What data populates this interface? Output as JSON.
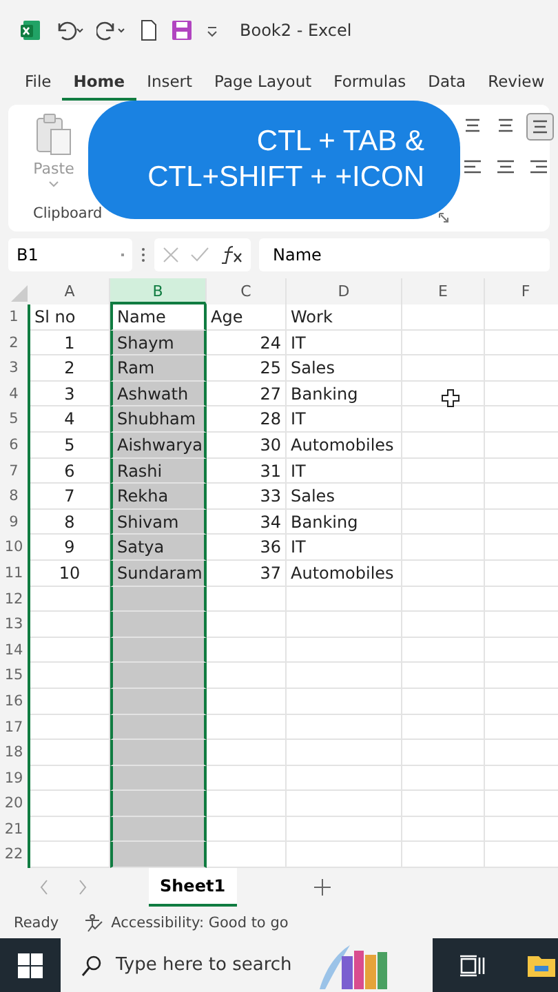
{
  "window": {
    "title": "Book2  -  Excel"
  },
  "ribbon_tabs": [
    {
      "label": "File",
      "selected": false
    },
    {
      "label": "Home",
      "selected": true
    },
    {
      "label": "Insert",
      "selected": false
    },
    {
      "label": "Page Layout",
      "selected": false
    },
    {
      "label": "Formulas",
      "selected": false
    },
    {
      "label": "Data",
      "selected": false
    },
    {
      "label": "Review",
      "selected": false
    }
  ],
  "ribbon": {
    "paste_label": "Paste",
    "group_label": "Clipboard"
  },
  "callout": {
    "lines": [
      "CTL + TAB &",
      "CTL+SHIFT + +ICON"
    ]
  },
  "formula_bar": {
    "name_box": "B1",
    "formula": "Name"
  },
  "columns": [
    {
      "label": "A",
      "selected": false
    },
    {
      "label": "B",
      "selected": true
    },
    {
      "label": "C",
      "selected": false
    },
    {
      "label": "D",
      "selected": false
    },
    {
      "label": "E",
      "selected": false
    },
    {
      "label": "F",
      "selected": false
    }
  ],
  "rows": [
    {
      "number": "1",
      "cells": [
        "Sl no",
        "Name",
        "Age",
        "Work"
      ]
    },
    {
      "number": "2",
      "cells": [
        "1",
        "Shaym",
        "24",
        "IT"
      ]
    },
    {
      "number": "3",
      "cells": [
        "2",
        "Ram",
        "25",
        "Sales"
      ]
    },
    {
      "number": "4",
      "cells": [
        "3",
        "Ashwath",
        "27",
        "Banking"
      ]
    },
    {
      "number": "5",
      "cells": [
        "4",
        "Shubham",
        "28",
        "IT"
      ]
    },
    {
      "number": "6",
      "cells": [
        "5",
        "Aishwarya",
        "30",
        "Automobiles"
      ]
    },
    {
      "number": "7",
      "cells": [
        "6",
        "Rashi",
        "31",
        "IT"
      ]
    },
    {
      "number": "8",
      "cells": [
        "7",
        "Rekha",
        "33",
        "Sales"
      ]
    },
    {
      "number": "9",
      "cells": [
        "8",
        "Shivam",
        "34",
        "Banking"
      ]
    },
    {
      "number": "10",
      "cells": [
        "9",
        "Satya",
        "36",
        "IT"
      ]
    },
    {
      "number": "11",
      "cells": [
        "10",
        "Sundaram",
        "37",
        "Automobiles"
      ]
    },
    {
      "number": "12"
    },
    {
      "number": "13"
    },
    {
      "number": "14"
    },
    {
      "number": "15"
    },
    {
      "number": "16"
    },
    {
      "number": "17"
    },
    {
      "number": "18"
    },
    {
      "number": "19"
    },
    {
      "number": "20"
    },
    {
      "number": "21"
    },
    {
      "number": "22"
    }
  ],
  "sheet_tabs": [
    {
      "label": "Sheet1",
      "selected": true
    }
  ],
  "status_bar": {
    "mode": "Ready",
    "accessibility": "Accessibility: Good to go"
  },
  "taskbar": {
    "search_placeholder": "Type here to search"
  }
}
